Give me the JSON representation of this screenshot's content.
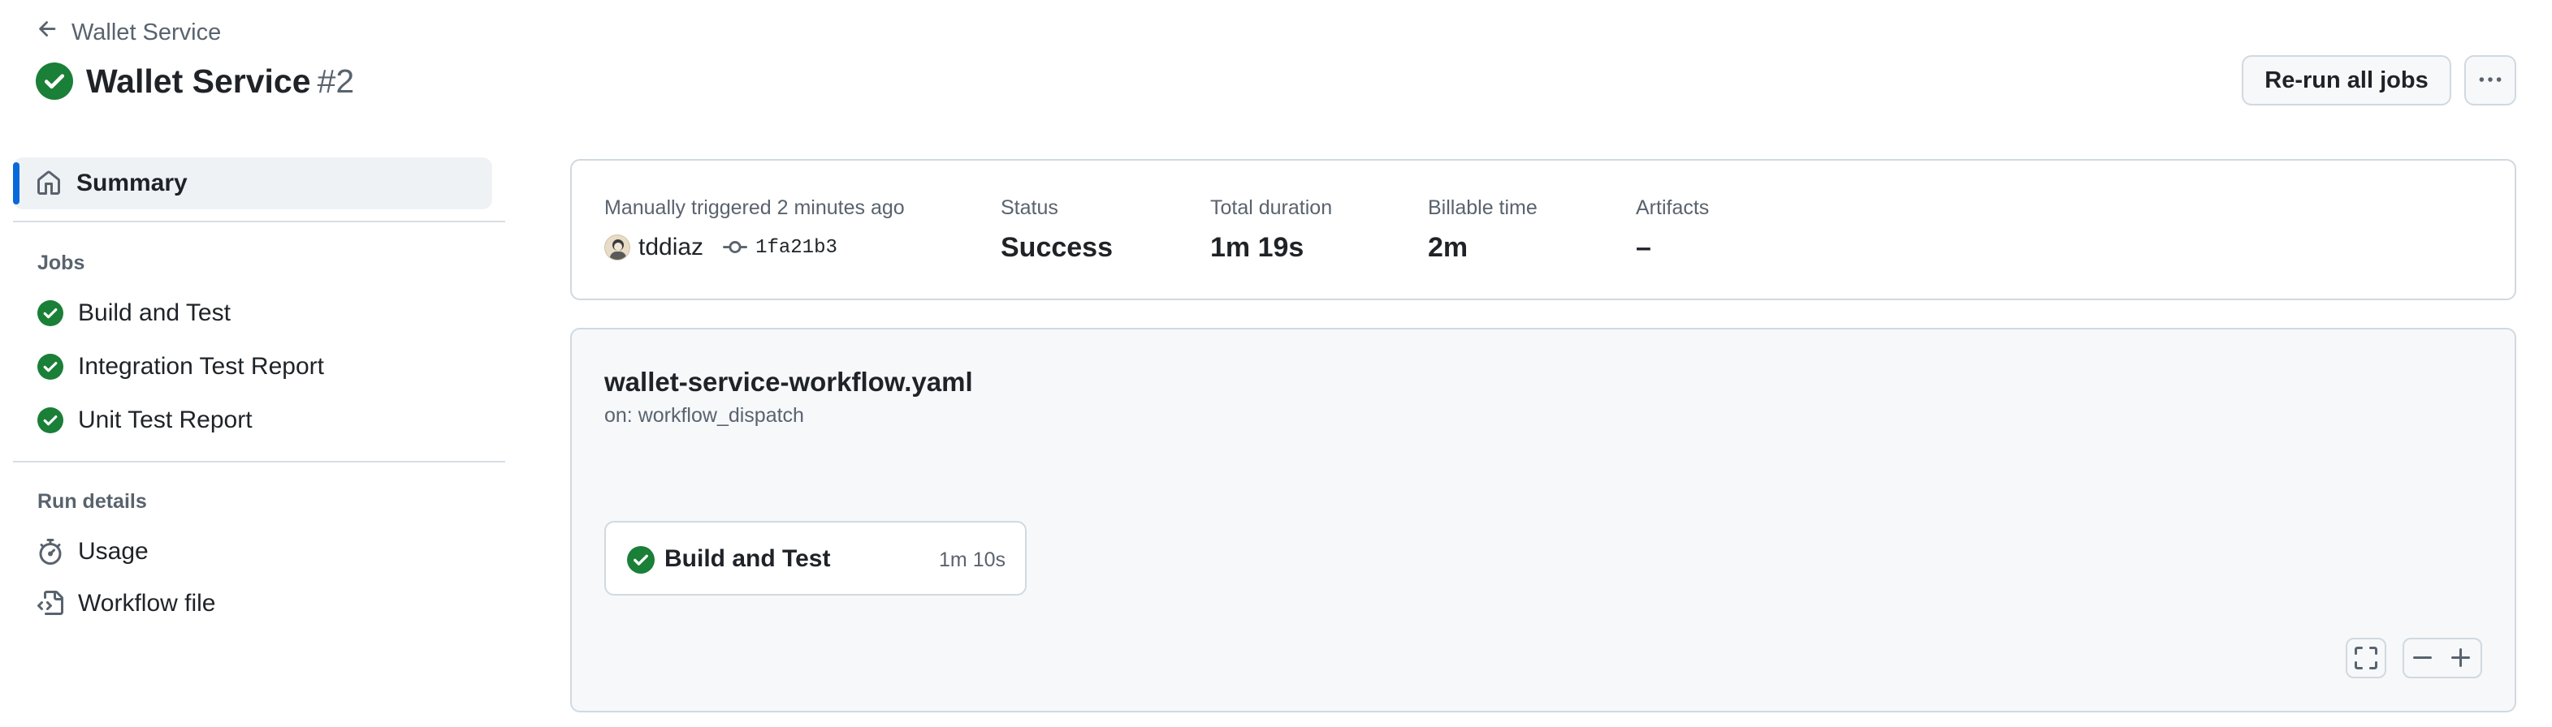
{
  "header": {
    "back_label": "Wallet Service",
    "title": "Wallet Service",
    "run_number": "#2",
    "rerun_label": "Re-run all jobs"
  },
  "sidebar": {
    "summary_label": "Summary",
    "jobs_title": "Jobs",
    "jobs": [
      {
        "label": "Build and Test",
        "status": "success"
      },
      {
        "label": "Integration Test Report",
        "status": "success"
      },
      {
        "label": "Unit Test Report",
        "status": "success"
      }
    ],
    "run_details_title": "Run details",
    "run_details": [
      {
        "label": "Usage",
        "icon": "stopwatch-icon"
      },
      {
        "label": "Workflow file",
        "icon": "file-code-icon"
      }
    ]
  },
  "summary": {
    "trigger_text": "Manually triggered 2 minutes ago",
    "actor": "tddiaz",
    "commit_sha": "1fa21b3",
    "status_label": "Status",
    "status_value": "Success",
    "duration_label": "Total duration",
    "duration_value": "1m 19s",
    "billable_label": "Billable time",
    "billable_value": "2m",
    "artifacts_label": "Artifacts",
    "artifacts_value": "–"
  },
  "graph": {
    "workflow_file": "wallet-service-workflow.yaml",
    "trigger": "on: workflow_dispatch",
    "job": {
      "name": "Build and Test",
      "duration": "1m 10s",
      "status": "success"
    }
  },
  "colors": {
    "success": "#1a7f37",
    "accent": "#0969da",
    "border": "#d1d9e0",
    "muted_text": "#59636e"
  }
}
